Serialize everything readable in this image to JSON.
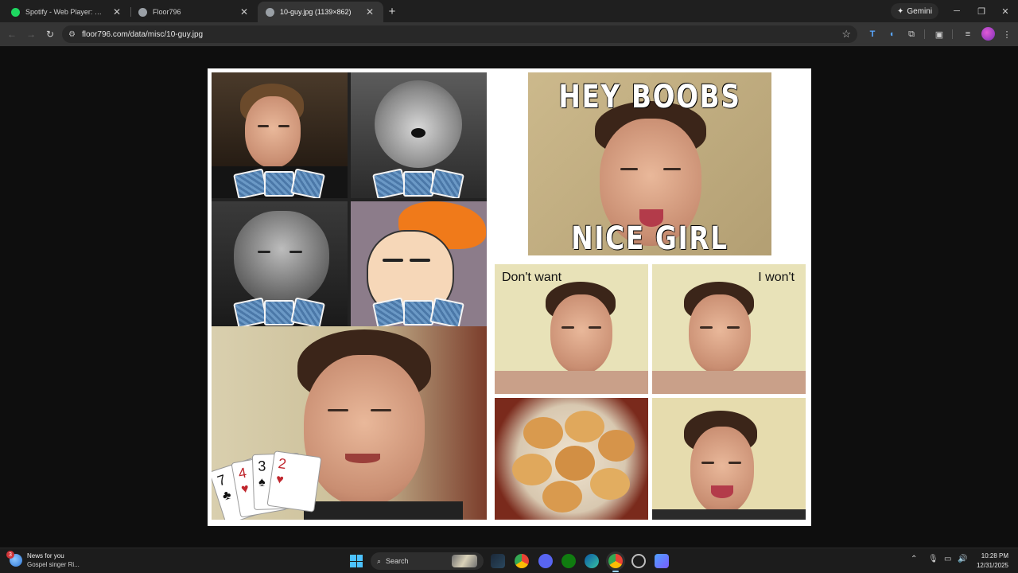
{
  "browser": {
    "tabs": [
      {
        "title": "Spotify - Web Player: Music for",
        "favicon": "spotify-icon",
        "color": "#1ed760",
        "active": false
      },
      {
        "title": "Floor796",
        "favicon": "floor796-icon",
        "color": "#9aa0a6",
        "active": false
      },
      {
        "title": "10-guy.jpg (1139×862)",
        "favicon": "floor796-icon",
        "color": "#9aa0a6",
        "active": true
      }
    ],
    "new_tab_icon": "plus-icon",
    "gemini_label": "Gemini",
    "address": {
      "url": "floor796.com/data/misc/10-guy.jpg"
    }
  },
  "image": {
    "caption_top": "HEY BOOBS",
    "caption_bottom": "NICE GIRL",
    "label_left": "Don't want",
    "label_right": "I won't"
  },
  "taskbar": {
    "news_title": "News for you",
    "news_subtitle": "Gospel singer Ri...",
    "news_badge": "3",
    "search_label": "Search",
    "time": "10:28 PM",
    "date": "12/31/2025"
  },
  "colors": {
    "accent": "#4cc2ff",
    "spotify": "#1ed760"
  }
}
